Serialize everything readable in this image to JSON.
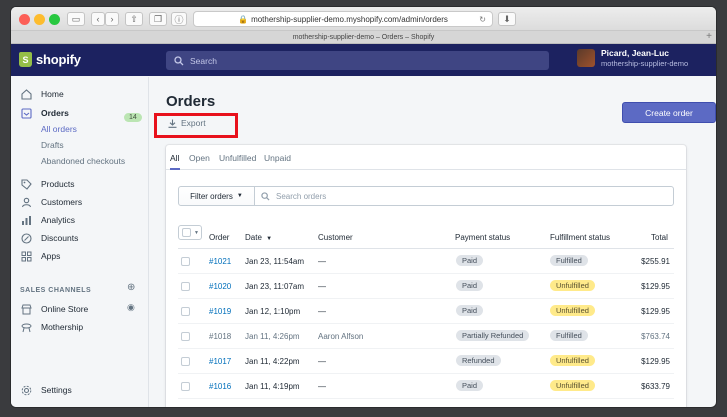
{
  "browser": {
    "url": "mothership-supplier-demo.myshopify.com/admin/orders",
    "tab_title": "mothership-supplier-demo – Orders – Shopify"
  },
  "topbar": {
    "logo_text": "shopify",
    "search_placeholder": "Search",
    "user_name": "Picard, Jean-Luc",
    "store_name": "mothership-supplier-demo"
  },
  "sidebar": {
    "items": [
      {
        "label": "Home",
        "icon": "home-icon"
      },
      {
        "label": "Orders",
        "icon": "orders-icon",
        "badge": "14"
      },
      {
        "label": "Products",
        "icon": "tag-icon"
      },
      {
        "label": "Customers",
        "icon": "person-icon"
      },
      {
        "label": "Analytics",
        "icon": "bar-chart-icon"
      },
      {
        "label": "Discounts",
        "icon": "discount-icon"
      },
      {
        "label": "Apps",
        "icon": "apps-icon"
      }
    ],
    "order_subitems": [
      "All orders",
      "Drafts",
      "Abandoned checkouts"
    ],
    "sales_channels_heading": "SALES CHANNELS",
    "channels": [
      {
        "label": "Online Store",
        "icon": "store-icon"
      },
      {
        "label": "Mothership",
        "icon": "mothership-icon"
      }
    ],
    "settings_label": "Settings"
  },
  "main": {
    "title": "Orders",
    "export_label": "Export",
    "create_label": "Create order",
    "tabs": [
      "All",
      "Open",
      "Unfulfilled",
      "Unpaid"
    ],
    "filter_label": "Filter orders",
    "search_placeholder": "Search orders",
    "columns": [
      "Order",
      "Date",
      "Customer",
      "Payment status",
      "Fulfillment status",
      "Total"
    ],
    "rows": [
      {
        "order": "#1021",
        "date": "Jan 23, 11:54am",
        "customer": "—",
        "payment": "Paid",
        "fulfillment": "Fulfilled",
        "total": "$255.91"
      },
      {
        "order": "#1020",
        "date": "Jan 23, 11:07am",
        "customer": "—",
        "payment": "Paid",
        "fulfillment": "Unfulfilled",
        "total": "$129.95"
      },
      {
        "order": "#1019",
        "date": "Jan 12, 1:10pm",
        "customer": "—",
        "payment": "Paid",
        "fulfillment": "Unfulfilled",
        "total": "$129.95"
      },
      {
        "order": "#1018",
        "date": "Jan 11, 4:26pm",
        "customer": "Aaron Alfson",
        "payment": "Partially Refunded",
        "fulfillment": "Fulfilled",
        "total": "$763.74"
      },
      {
        "order": "#1017",
        "date": "Jan 11, 4:22pm",
        "customer": "—",
        "payment": "Refunded",
        "fulfillment": "Unfulfilled",
        "total": "$129.95"
      },
      {
        "order": "#1016",
        "date": "Jan 11, 4:19pm",
        "customer": "—",
        "payment": "Paid",
        "fulfillment": "Unfulfilled",
        "total": "$633.79"
      }
    ]
  },
  "colors": {
    "topbar": "#1c2260",
    "accent": "#5c6ac4",
    "link": "#006fbb",
    "highlight_box": "#e8111c",
    "unfulfilled_badge": "#ffea8a",
    "orders_badge": "#bbe5b3"
  }
}
